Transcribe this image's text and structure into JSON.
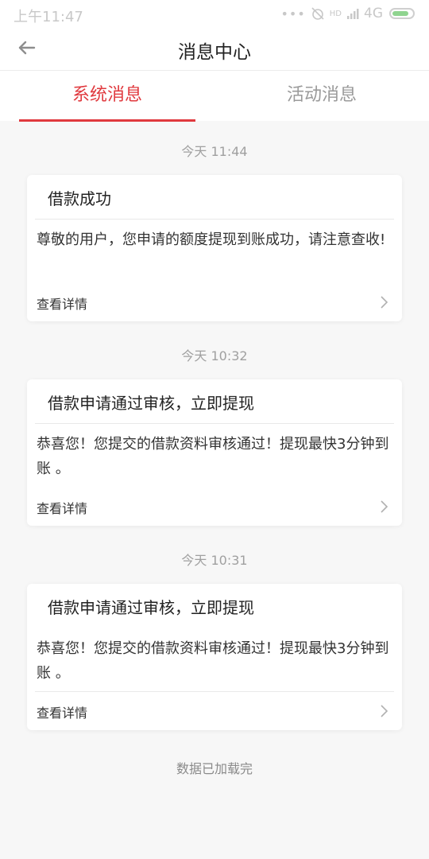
{
  "status_bar": {
    "time": "上午11:47",
    "network": "4G",
    "signal_label": "HD",
    "icons": [
      "more-dots-icon",
      "alarm-off-icon",
      "signal-icon",
      "battery-icon"
    ]
  },
  "header": {
    "title": "消息中心",
    "back_icon": "arrow-left-icon"
  },
  "tabs": [
    {
      "label": "系统消息",
      "active": true
    },
    {
      "label": "活动消息",
      "active": false
    }
  ],
  "messages": [
    {
      "time": "今天 11:44",
      "title": "借款成功",
      "body": "尊敬的用户，您申请的额度提现到账成功，请注意查收!",
      "detail_label": "查看详情"
    },
    {
      "time": "今天 10:32",
      "title": "借款申请通过审核，立即提现",
      "body": "恭喜您！您提交的借款资料审核通过！提现最快3分钟到账 。",
      "detail_label": "查看详情"
    },
    {
      "time": "今天 10:31",
      "title": "借款申请通过审核，立即提现",
      "body": "恭喜您！您提交的借款资料审核通过！提现最快3分钟到账 。",
      "detail_label": "查看详情"
    }
  ],
  "footer": {
    "text": "数据已加载完"
  },
  "colors": {
    "accent": "#e0393e",
    "background": "#f7f7f7",
    "muted": "#a0a0a0"
  }
}
